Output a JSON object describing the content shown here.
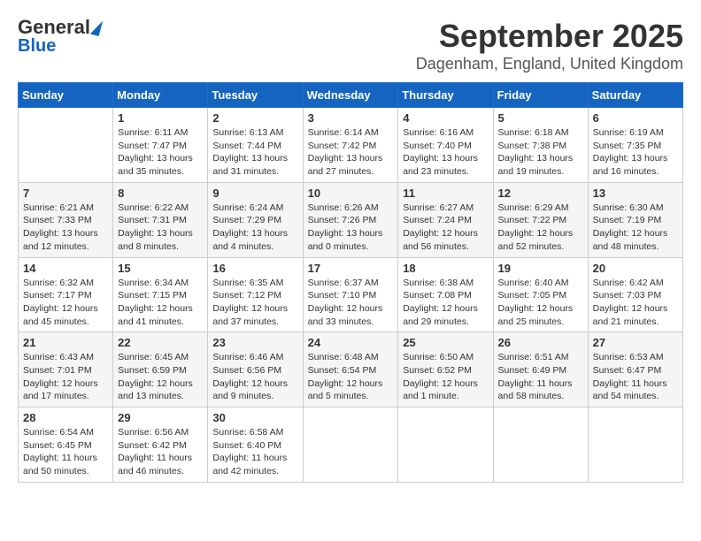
{
  "header": {
    "logo_line1": "General",
    "logo_line2": "Blue",
    "title": "September 2025",
    "subtitle": "Dagenham, England, United Kingdom"
  },
  "weekdays": [
    "Sunday",
    "Monday",
    "Tuesday",
    "Wednesday",
    "Thursday",
    "Friday",
    "Saturday"
  ],
  "weeks": [
    [
      {
        "day": "",
        "text": ""
      },
      {
        "day": "1",
        "text": "Sunrise: 6:11 AM\nSunset: 7:47 PM\nDaylight: 13 hours\nand 35 minutes."
      },
      {
        "day": "2",
        "text": "Sunrise: 6:13 AM\nSunset: 7:44 PM\nDaylight: 13 hours\nand 31 minutes."
      },
      {
        "day": "3",
        "text": "Sunrise: 6:14 AM\nSunset: 7:42 PM\nDaylight: 13 hours\nand 27 minutes."
      },
      {
        "day": "4",
        "text": "Sunrise: 6:16 AM\nSunset: 7:40 PM\nDaylight: 13 hours\nand 23 minutes."
      },
      {
        "day": "5",
        "text": "Sunrise: 6:18 AM\nSunset: 7:38 PM\nDaylight: 13 hours\nand 19 minutes."
      },
      {
        "day": "6",
        "text": "Sunrise: 6:19 AM\nSunset: 7:35 PM\nDaylight: 13 hours\nand 16 minutes."
      }
    ],
    [
      {
        "day": "7",
        "text": "Sunrise: 6:21 AM\nSunset: 7:33 PM\nDaylight: 13 hours\nand 12 minutes."
      },
      {
        "day": "8",
        "text": "Sunrise: 6:22 AM\nSunset: 7:31 PM\nDaylight: 13 hours\nand 8 minutes."
      },
      {
        "day": "9",
        "text": "Sunrise: 6:24 AM\nSunset: 7:29 PM\nDaylight: 13 hours\nand 4 minutes."
      },
      {
        "day": "10",
        "text": "Sunrise: 6:26 AM\nSunset: 7:26 PM\nDaylight: 13 hours\nand 0 minutes."
      },
      {
        "day": "11",
        "text": "Sunrise: 6:27 AM\nSunset: 7:24 PM\nDaylight: 12 hours\nand 56 minutes."
      },
      {
        "day": "12",
        "text": "Sunrise: 6:29 AM\nSunset: 7:22 PM\nDaylight: 12 hours\nand 52 minutes."
      },
      {
        "day": "13",
        "text": "Sunrise: 6:30 AM\nSunset: 7:19 PM\nDaylight: 12 hours\nand 48 minutes."
      }
    ],
    [
      {
        "day": "14",
        "text": "Sunrise: 6:32 AM\nSunset: 7:17 PM\nDaylight: 12 hours\nand 45 minutes."
      },
      {
        "day": "15",
        "text": "Sunrise: 6:34 AM\nSunset: 7:15 PM\nDaylight: 12 hours\nand 41 minutes."
      },
      {
        "day": "16",
        "text": "Sunrise: 6:35 AM\nSunset: 7:12 PM\nDaylight: 12 hours\nand 37 minutes."
      },
      {
        "day": "17",
        "text": "Sunrise: 6:37 AM\nSunset: 7:10 PM\nDaylight: 12 hours\nand 33 minutes."
      },
      {
        "day": "18",
        "text": "Sunrise: 6:38 AM\nSunset: 7:08 PM\nDaylight: 12 hours\nand 29 minutes."
      },
      {
        "day": "19",
        "text": "Sunrise: 6:40 AM\nSunset: 7:05 PM\nDaylight: 12 hours\nand 25 minutes."
      },
      {
        "day": "20",
        "text": "Sunrise: 6:42 AM\nSunset: 7:03 PM\nDaylight: 12 hours\nand 21 minutes."
      }
    ],
    [
      {
        "day": "21",
        "text": "Sunrise: 6:43 AM\nSunset: 7:01 PM\nDaylight: 12 hours\nand 17 minutes."
      },
      {
        "day": "22",
        "text": "Sunrise: 6:45 AM\nSunset: 6:59 PM\nDaylight: 12 hours\nand 13 minutes."
      },
      {
        "day": "23",
        "text": "Sunrise: 6:46 AM\nSunset: 6:56 PM\nDaylight: 12 hours\nand 9 minutes."
      },
      {
        "day": "24",
        "text": "Sunrise: 6:48 AM\nSunset: 6:54 PM\nDaylight: 12 hours\nand 5 minutes."
      },
      {
        "day": "25",
        "text": "Sunrise: 6:50 AM\nSunset: 6:52 PM\nDaylight: 12 hours\nand 1 minute."
      },
      {
        "day": "26",
        "text": "Sunrise: 6:51 AM\nSunset: 6:49 PM\nDaylight: 11 hours\nand 58 minutes."
      },
      {
        "day": "27",
        "text": "Sunrise: 6:53 AM\nSunset: 6:47 PM\nDaylight: 11 hours\nand 54 minutes."
      }
    ],
    [
      {
        "day": "28",
        "text": "Sunrise: 6:54 AM\nSunset: 6:45 PM\nDaylight: 11 hours\nand 50 minutes."
      },
      {
        "day": "29",
        "text": "Sunrise: 6:56 AM\nSunset: 6:42 PM\nDaylight: 11 hours\nand 46 minutes."
      },
      {
        "day": "30",
        "text": "Sunrise: 6:58 AM\nSunset: 6:40 PM\nDaylight: 11 hours\nand 42 minutes."
      },
      {
        "day": "",
        "text": ""
      },
      {
        "day": "",
        "text": ""
      },
      {
        "day": "",
        "text": ""
      },
      {
        "day": "",
        "text": ""
      }
    ]
  ]
}
